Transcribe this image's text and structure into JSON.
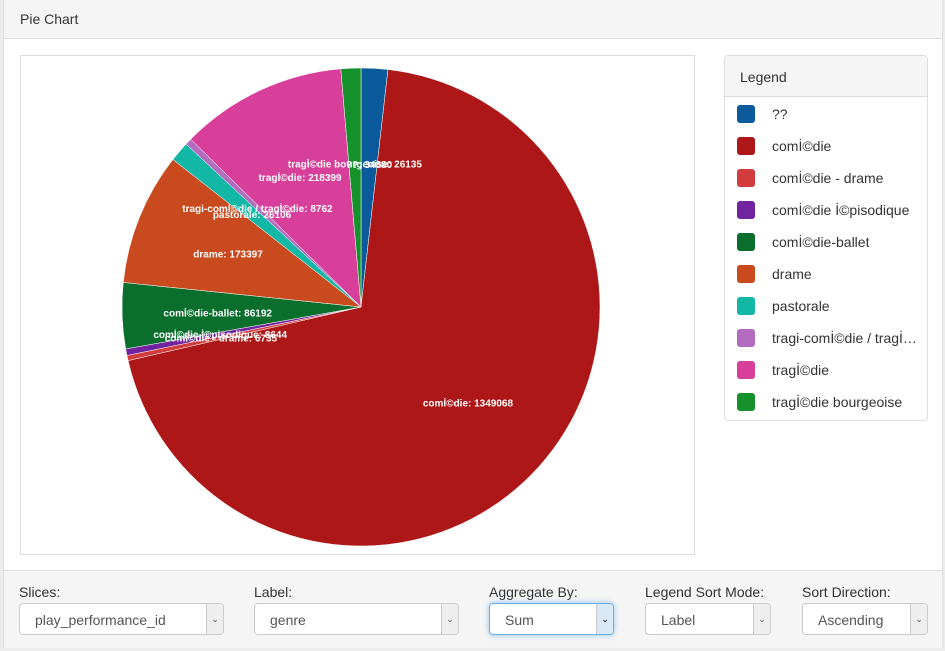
{
  "panel": {
    "title": "Pie Chart"
  },
  "legend": {
    "title": "Legend",
    "items": [
      {
        "label": "??",
        "color": "#0a5a9c"
      },
      {
        "label": "comİ©die",
        "color": "#ad1717"
      },
      {
        "label": "comİ©die - drame",
        "color": "#d23c3c"
      },
      {
        "label": "comİ©die İ©pisodique",
        "color": "#7224a0"
      },
      {
        "label": "comİ©die-ballet",
        "color": "#0a6e2c"
      },
      {
        "label": "drame",
        "color": "#c94a1e"
      },
      {
        "label": "pastorale",
        "color": "#12b8a5"
      },
      {
        "label": "tragi-comİ©die / tragİ©die",
        "color": "#b46cc0"
      },
      {
        "label": "tragİ©die",
        "color": "#d83f9a"
      },
      {
        "label": "tragİ©die bourgeoise",
        "color": "#16922c"
      }
    ]
  },
  "chart_data": {
    "type": "pie",
    "title": "",
    "start": "12 o'clock, clockwise",
    "slices": [
      {
        "label": "??",
        "value": 34880,
        "color": "#0a5a9c"
      },
      {
        "label": "comİ©die",
        "value": 1349068,
        "color": "#ad1717"
      },
      {
        "label": "comİ©die - drame",
        "value": 6735,
        "color": "#d23c3c"
      },
      {
        "label": "comİ©die İ©pisodique",
        "value": 8644,
        "color": "#7224a0"
      },
      {
        "label": "comİ©die-ballet",
        "value": 86192,
        "color": "#0a6e2c"
      },
      {
        "label": "drame",
        "value": 173397,
        "color": "#c94a1e"
      },
      {
        "label": "pastorale",
        "value": 26106,
        "color": "#12b8a5"
      },
      {
        "label": "tragi-comİ©die / tragİ©die",
        "value": 8762,
        "color": "#b46cc0"
      },
      {
        "label": "tragİ©die",
        "value": 218399,
        "color": "#d83f9a"
      },
      {
        "label": "tragİ©die bourgeoise",
        "value": 26135,
        "color": "#16922c"
      }
    ]
  },
  "controls": {
    "slices": {
      "label": "Slices:",
      "value": "play_performance_id"
    },
    "label": {
      "label": "Label:",
      "value": "genre"
    },
    "aggregate": {
      "label": "Aggregate By:",
      "value": "Sum"
    },
    "legend_sort": {
      "label": "Legend Sort Mode:",
      "value": "Label"
    },
    "sort_direction": {
      "label": "Sort Direction:",
      "value": "Ascending"
    }
  }
}
